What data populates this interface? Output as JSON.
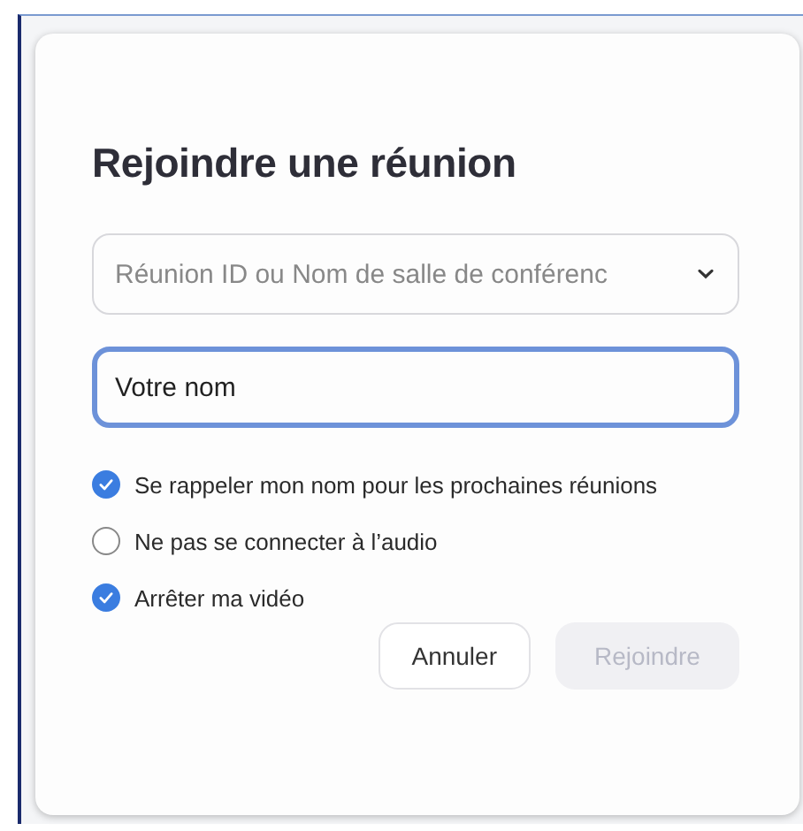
{
  "dialog": {
    "title": "Rejoindre une réunion",
    "meeting_field": {
      "placeholder": "Réunion ID ou Nom de salle de conférenc",
      "dropdown": true
    },
    "name_field": {
      "value": "Votre nom",
      "focused": true
    },
    "options": [
      {
        "label": "Se rappeler mon nom pour les prochaines réunions",
        "checked": true
      },
      {
        "label": "Ne pas se connecter à l’audio",
        "checked": false
      },
      {
        "label": "Arrêter ma vidéo",
        "checked": true
      }
    ],
    "buttons": [
      {
        "label": "Annuler",
        "kind": "secondary",
        "disabled": false
      },
      {
        "label": "Rejoindre",
        "kind": "primary",
        "disabled": true
      }
    ]
  }
}
